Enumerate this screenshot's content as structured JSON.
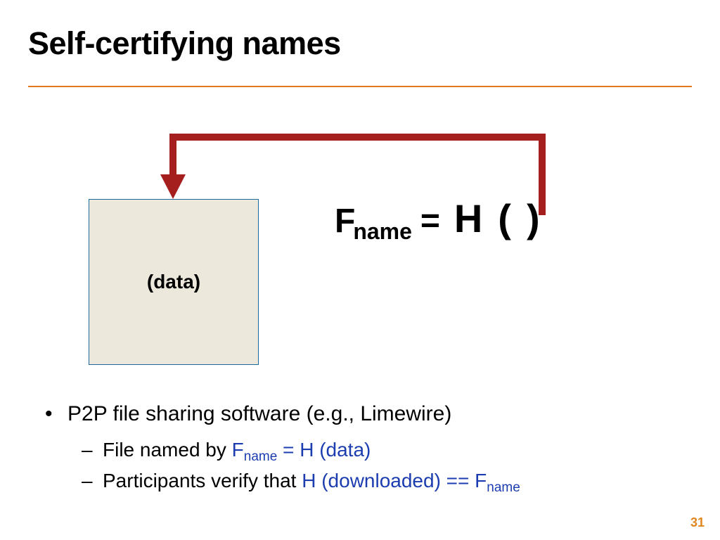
{
  "title": "Self-certifying names",
  "diagram": {
    "box_label": "(data)",
    "formula": {
      "F": "F",
      "sub": "name",
      "eq": "=",
      "H_open": "H(",
      "H_close": ")"
    }
  },
  "bullets": {
    "item1": "P2P file sharing software (e.g., Limewire)",
    "item2a_prefix": "File named by   ",
    "item2a_F": "F",
    "item2a_sub": "name",
    "item2a_rest": " = H (data)",
    "item2b_prefix": "Participants verify that   ",
    "item2b_h": "H (downloaded) == F",
    "item2b_sub": "name"
  },
  "page": "31"
}
